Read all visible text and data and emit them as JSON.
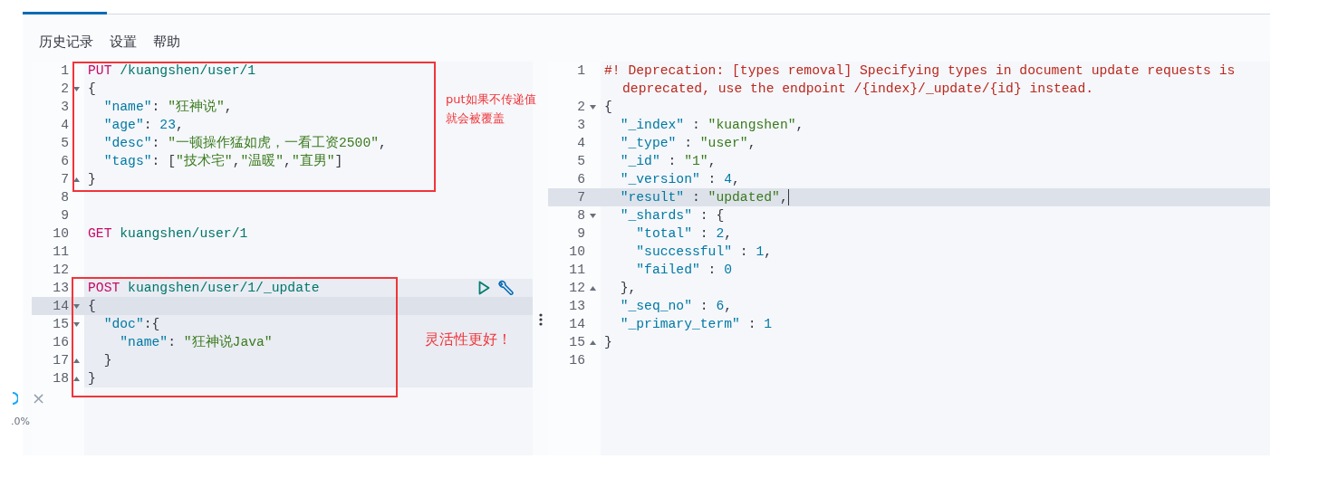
{
  "sidebar": {
    "close": "×",
    "percent": ".0%"
  },
  "menu": [
    {
      "label": "历史记录"
    },
    {
      "label": "设置"
    },
    {
      "label": "帮助"
    }
  ],
  "request_editor": {
    "lines": [
      {
        "number": "1",
        "fold_start": false,
        "fold_end": false,
        "selected": false,
        "request_highlight": false,
        "actions": false,
        "tokens": [
          {
            "kind": "method",
            "text": "PUT"
          },
          {
            "kind": "path",
            "text": " /kuangshen/user/1"
          }
        ]
      },
      {
        "number": "2",
        "fold_start": true,
        "fold_end": false,
        "selected": false,
        "request_highlight": false,
        "actions": false,
        "tokens": [
          {
            "kind": "punct",
            "text": "{"
          }
        ]
      },
      {
        "number": "3",
        "fold_start": false,
        "fold_end": false,
        "selected": false,
        "request_highlight": false,
        "actions": false,
        "tokens": [
          {
            "kind": "key",
            "text": "  \"name\""
          },
          {
            "kind": "punct",
            "text": ": "
          },
          {
            "kind": "string",
            "text": "\"狂神说\""
          },
          {
            "kind": "punct",
            "text": ","
          }
        ]
      },
      {
        "number": "4",
        "fold_start": false,
        "fold_end": false,
        "selected": false,
        "request_highlight": false,
        "actions": false,
        "tokens": [
          {
            "kind": "key",
            "text": "  \"age\""
          },
          {
            "kind": "punct",
            "text": ": "
          },
          {
            "kind": "number",
            "text": "23"
          },
          {
            "kind": "punct",
            "text": ","
          }
        ]
      },
      {
        "number": "5",
        "fold_start": false,
        "fold_end": false,
        "selected": false,
        "request_highlight": false,
        "actions": false,
        "tokens": [
          {
            "kind": "key",
            "text": "  \"desc\""
          },
          {
            "kind": "punct",
            "text": ": "
          },
          {
            "kind": "string",
            "text": "\"一顿操作猛如虎，一看工资2500\""
          },
          {
            "kind": "punct",
            "text": ","
          }
        ]
      },
      {
        "number": "6",
        "fold_start": false,
        "fold_end": false,
        "selected": false,
        "request_highlight": false,
        "actions": false,
        "tokens": [
          {
            "kind": "key",
            "text": "  \"tags\""
          },
          {
            "kind": "punct",
            "text": ": ["
          },
          {
            "kind": "string",
            "text": "\"技术宅\""
          },
          {
            "kind": "punct",
            "text": ","
          },
          {
            "kind": "string",
            "text": "\"温暖\""
          },
          {
            "kind": "punct",
            "text": ","
          },
          {
            "kind": "string",
            "text": "\"直男\""
          },
          {
            "kind": "punct",
            "text": "]"
          }
        ]
      },
      {
        "number": "7",
        "fold_start": false,
        "fold_end": true,
        "selected": false,
        "request_highlight": false,
        "actions": false,
        "tokens": [
          {
            "kind": "punct",
            "text": "}"
          }
        ]
      },
      {
        "number": "8",
        "fold_start": false,
        "fold_end": false,
        "selected": false,
        "request_highlight": false,
        "actions": false
      },
      {
        "number": "9",
        "fold_start": false,
        "fold_end": false,
        "selected": false,
        "request_highlight": false,
        "actions": false
      },
      {
        "number": "10",
        "fold_start": false,
        "fold_end": false,
        "selected": false,
        "request_highlight": false,
        "actions": false,
        "tokens": [
          {
            "kind": "method",
            "text": "GET"
          },
          {
            "kind": "path",
            "text": " kuangshen/user/1"
          }
        ]
      },
      {
        "number": "11",
        "fold_start": false,
        "fold_end": false,
        "selected": false,
        "request_highlight": false,
        "actions": false
      },
      {
        "number": "12",
        "fold_start": false,
        "fold_end": false,
        "selected": false,
        "request_highlight": false,
        "actions": false
      },
      {
        "number": "13",
        "fold_start": false,
        "fold_end": false,
        "selected": false,
        "request_highlight": true,
        "actions": true,
        "tokens": [
          {
            "kind": "method",
            "text": "POST"
          },
          {
            "kind": "path",
            "text": " kuangshen/user/1/_update"
          }
        ]
      },
      {
        "number": "14",
        "fold_start": true,
        "fold_end": false,
        "selected": true,
        "request_highlight": true,
        "actions": false,
        "tokens": [
          {
            "kind": "punct",
            "text": "{"
          }
        ]
      },
      {
        "number": "15",
        "fold_start": true,
        "fold_end": false,
        "selected": false,
        "request_highlight": true,
        "actions": false,
        "tokens": [
          {
            "kind": "key",
            "text": "  \"doc\""
          },
          {
            "kind": "punct",
            "text": ":{"
          }
        ]
      },
      {
        "number": "16",
        "fold_start": false,
        "fold_end": false,
        "selected": false,
        "request_highlight": true,
        "actions": false,
        "tokens": [
          {
            "kind": "key",
            "text": "    \"name\""
          },
          {
            "kind": "punct",
            "text": ": "
          },
          {
            "kind": "string",
            "text": "\"狂神说Java\""
          }
        ]
      },
      {
        "number": "17",
        "fold_start": false,
        "fold_end": true,
        "selected": false,
        "request_highlight": true,
        "actions": false,
        "tokens": [
          {
            "kind": "punct",
            "text": "  }"
          }
        ]
      },
      {
        "number": "18",
        "fold_start": false,
        "fold_end": true,
        "selected": false,
        "request_highlight": true,
        "actions": false,
        "tokens": [
          {
            "kind": "punct",
            "text": "}"
          }
        ]
      }
    ]
  },
  "response_editor": {
    "lines": [
      {
        "number": "1",
        "fold_start": false,
        "fold_end": false,
        "selected": false,
        "cursor": false,
        "tokens": [
          {
            "kind": "comment",
            "text": "#! Deprecation: [types removal] Specifying types in document update requests is deprecated, use the endpoint /{index}/_update/{id} instead."
          }
        ]
      },
      {
        "number": "2",
        "fold_start": true,
        "fold_end": false,
        "selected": false,
        "cursor": false,
        "tokens": [
          {
            "kind": "punct",
            "text": "{"
          }
        ]
      },
      {
        "number": "3",
        "fold_start": false,
        "fold_end": false,
        "selected": false,
        "cursor": false,
        "tokens": [
          {
            "kind": "key",
            "text": "  \"_index\""
          },
          {
            "kind": "punct",
            "text": " : "
          },
          {
            "kind": "string",
            "text": "\"kuangshen\""
          },
          {
            "kind": "punct",
            "text": ","
          }
        ]
      },
      {
        "number": "4",
        "fold_start": false,
        "fold_end": false,
        "selected": false,
        "cursor": false,
        "tokens": [
          {
            "kind": "key",
            "text": "  \"_type\""
          },
          {
            "kind": "punct",
            "text": " : "
          },
          {
            "kind": "string",
            "text": "\"user\""
          },
          {
            "kind": "punct",
            "text": ","
          }
        ]
      },
      {
        "number": "5",
        "fold_start": false,
        "fold_end": false,
        "selected": false,
        "cursor": false,
        "tokens": [
          {
            "kind": "key",
            "text": "  \"_id\""
          },
          {
            "kind": "punct",
            "text": " : "
          },
          {
            "kind": "string",
            "text": "\"1\""
          },
          {
            "kind": "punct",
            "text": ","
          }
        ]
      },
      {
        "number": "6",
        "fold_start": false,
        "fold_end": false,
        "selected": false,
        "cursor": false,
        "tokens": [
          {
            "kind": "key",
            "text": "  \"_version\""
          },
          {
            "kind": "punct",
            "text": " : "
          },
          {
            "kind": "number",
            "text": "4"
          },
          {
            "kind": "punct",
            "text": ","
          }
        ]
      },
      {
        "number": "7",
        "fold_start": false,
        "fold_end": false,
        "selected": true,
        "cursor": true,
        "tokens": [
          {
            "kind": "key",
            "text": "  \"result\""
          },
          {
            "kind": "punct",
            "text": " : "
          },
          {
            "kind": "string",
            "text": "\"updated\""
          },
          {
            "kind": "punct",
            "text": ","
          }
        ]
      },
      {
        "number": "8",
        "fold_start": true,
        "fold_end": false,
        "selected": false,
        "cursor": false,
        "tokens": [
          {
            "kind": "key",
            "text": "  \"_shards\""
          },
          {
            "kind": "punct",
            "text": " : {"
          }
        ]
      },
      {
        "number": "9",
        "fold_start": false,
        "fold_end": false,
        "selected": false,
        "cursor": false,
        "tokens": [
          {
            "kind": "key",
            "text": "    \"total\""
          },
          {
            "kind": "punct",
            "text": " : "
          },
          {
            "kind": "number",
            "text": "2"
          },
          {
            "kind": "punct",
            "text": ","
          }
        ]
      },
      {
        "number": "10",
        "fold_start": false,
        "fold_end": false,
        "selected": false,
        "cursor": false,
        "tokens": [
          {
            "kind": "key",
            "text": "    \"successful\""
          },
          {
            "kind": "punct",
            "text": " : "
          },
          {
            "kind": "number",
            "text": "1"
          },
          {
            "kind": "punct",
            "text": ","
          }
        ]
      },
      {
        "number": "11",
        "fold_start": false,
        "fold_end": false,
        "selected": false,
        "cursor": false,
        "tokens": [
          {
            "kind": "key",
            "text": "    \"failed\""
          },
          {
            "kind": "punct",
            "text": " : "
          },
          {
            "kind": "number",
            "text": "0"
          }
        ]
      },
      {
        "number": "12",
        "fold_start": false,
        "fold_end": true,
        "selected": false,
        "cursor": false,
        "tokens": [
          {
            "kind": "punct",
            "text": "  },"
          }
        ]
      },
      {
        "number": "13",
        "fold_start": false,
        "fold_end": false,
        "selected": false,
        "cursor": false,
        "tokens": [
          {
            "kind": "key",
            "text": "  \"_seq_no\""
          },
          {
            "kind": "punct",
            "text": " : "
          },
          {
            "kind": "number",
            "text": "6"
          },
          {
            "kind": "punct",
            "text": ","
          }
        ]
      },
      {
        "number": "14",
        "fold_start": false,
        "fold_end": false,
        "selected": false,
        "cursor": false,
        "tokens": [
          {
            "kind": "key",
            "text": "  \"_primary_term\""
          },
          {
            "kind": "punct",
            "text": " : "
          },
          {
            "kind": "number",
            "text": "1"
          }
        ]
      },
      {
        "number": "15",
        "fold_start": false,
        "fold_end": true,
        "selected": false,
        "cursor": false,
        "tokens": [
          {
            "kind": "punct",
            "text": "}"
          }
        ]
      },
      {
        "number": "16",
        "fold_start": false,
        "fold_end": false,
        "selected": false,
        "cursor": false
      }
    ]
  },
  "annotations": [
    {
      "text": "put如果不传递值就会被覆盖"
    },
    {
      "text": "灵活性更好！"
    }
  ]
}
